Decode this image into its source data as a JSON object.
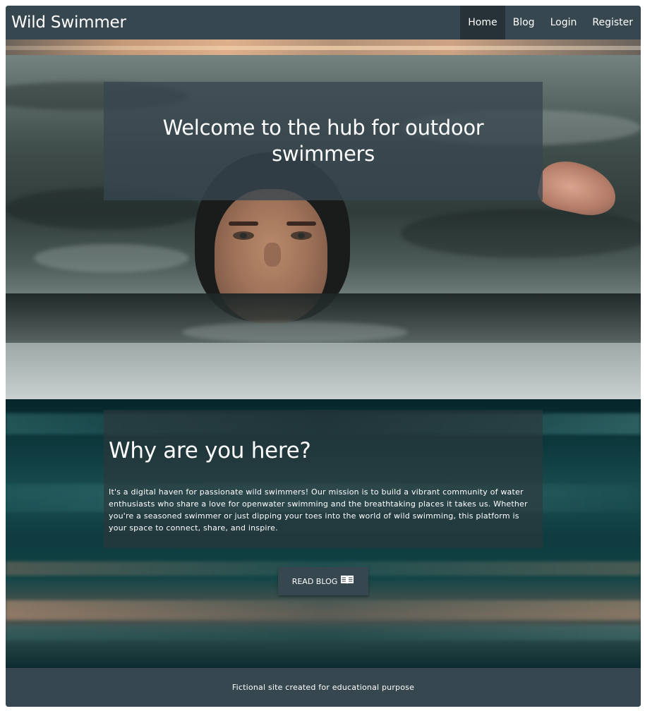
{
  "brand": "Wild Swimmer",
  "nav": {
    "items": [
      {
        "label": "Home",
        "active": true
      },
      {
        "label": "Blog",
        "active": false
      },
      {
        "label": "Login",
        "active": false
      },
      {
        "label": "Register",
        "active": false
      }
    ]
  },
  "hero": {
    "title": "Welcome to the hub for outdoor swimmers"
  },
  "about": {
    "title": "Why are you here?",
    "text": "It's a digital haven for passionate wild swimmers! Our mission is to build a vibrant community of water enthusiasts who share a love for openwater swimming and the breathtaking places it takes us. Whether you're a seasoned swimmer or just dipping your toes into the world of wild swimming, this platform is your space to connect, share, and inspire.",
    "button_label": "READ BLOG",
    "button_icon": "open-book-icon"
  },
  "footer": {
    "text": "Fictional site created for educational purpose"
  },
  "colors": {
    "navbar": "#37474f",
    "nav_active": "#263238",
    "footer": "#37474f",
    "button": "#37474f"
  }
}
